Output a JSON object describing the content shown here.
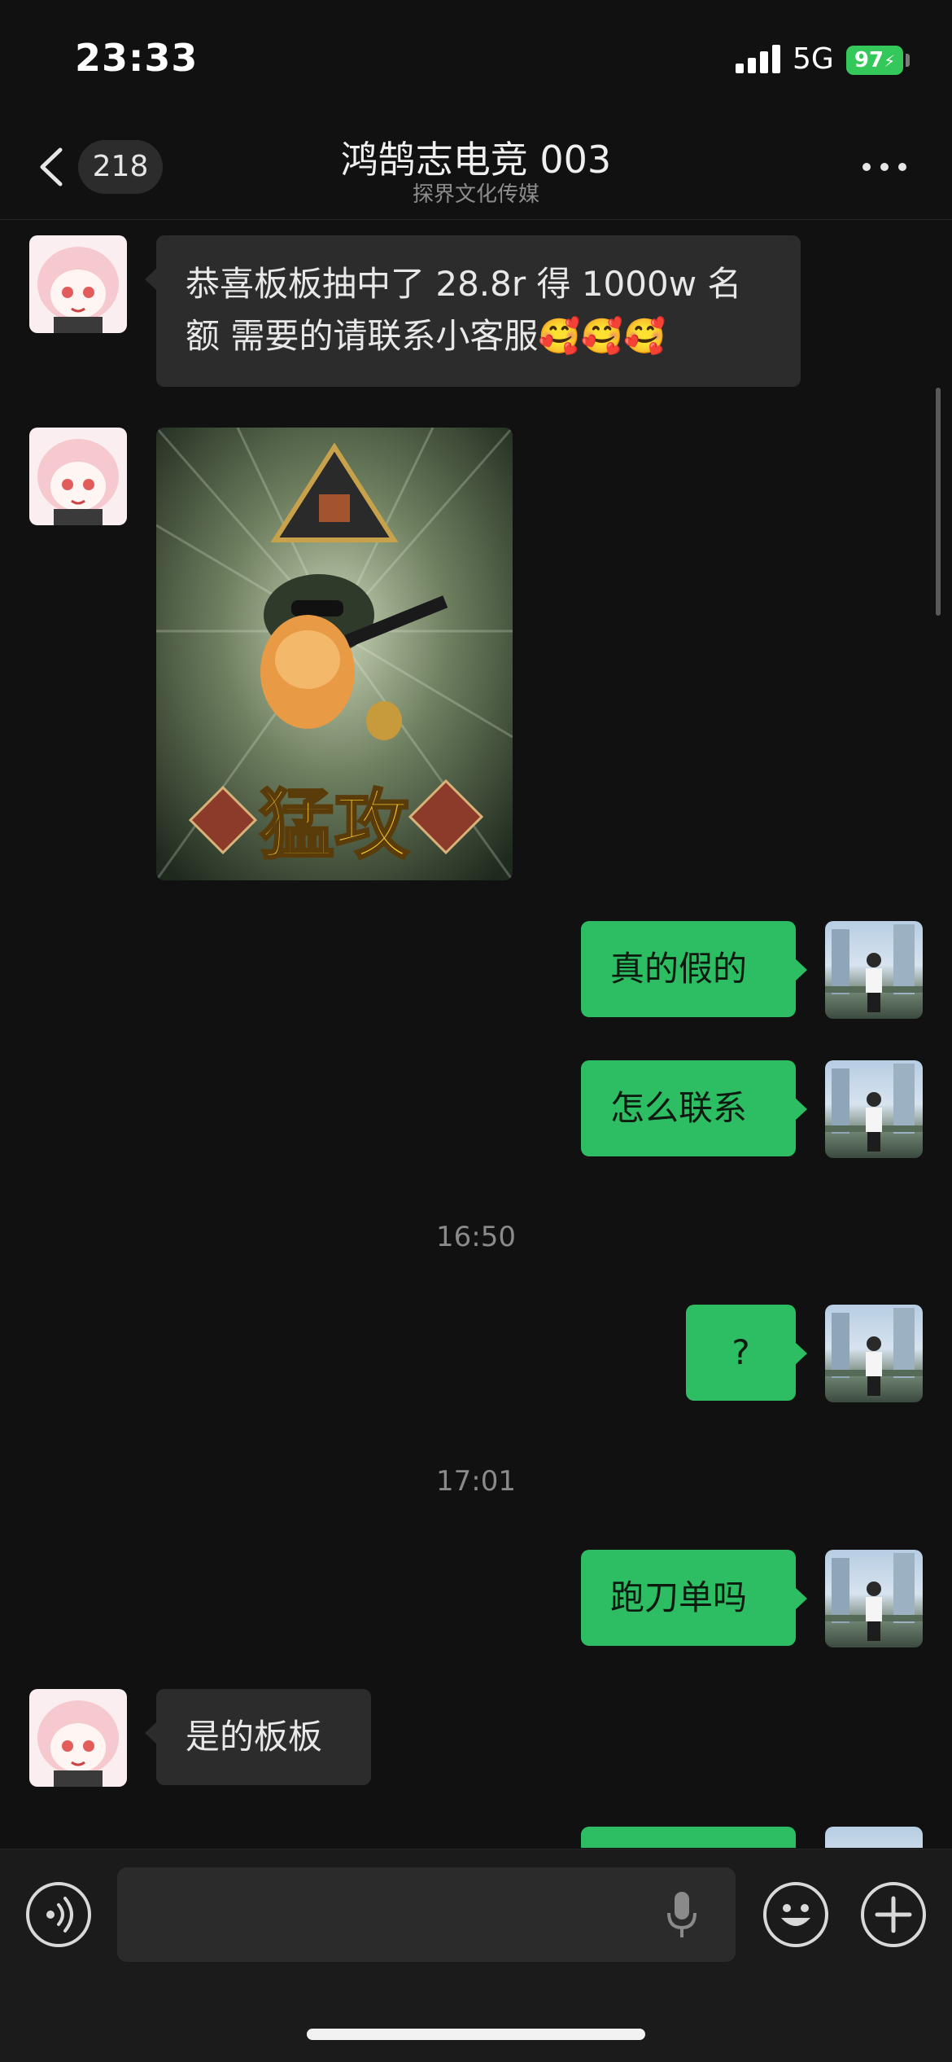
{
  "status_bar": {
    "time": "23:33",
    "network": "5G",
    "battery": "97"
  },
  "nav": {
    "unread_count": "218",
    "title": "鸿鹄志电竞 003",
    "subtitle": "探界文化传媒"
  },
  "messages": [
    {
      "type": "text",
      "direction": "in",
      "text": "恭喜板板抽中了 28.8r 得 1000w 名额 需要的请联系小客服🥰🥰🥰"
    },
    {
      "type": "image",
      "direction": "in",
      "caption": "猛攻"
    },
    {
      "type": "text",
      "direction": "out",
      "text": "真的假的"
    },
    {
      "type": "text",
      "direction": "out",
      "text": "怎么联系"
    },
    {
      "type": "timestamp",
      "text": "16:50"
    },
    {
      "type": "text",
      "direction": "out",
      "text": "?"
    },
    {
      "type": "timestamp",
      "text": "17:01"
    },
    {
      "type": "text",
      "direction": "out",
      "text": "跑刀单吗"
    },
    {
      "type": "text",
      "direction": "in",
      "text": "是的板板"
    }
  ],
  "colors": {
    "outgoing_bubble": "#2dbd63",
    "incoming_bubble": "#2c2c2c",
    "background": "#111111"
  },
  "icons": [
    "back-chevron-icon",
    "more-icon",
    "voice-icon",
    "microphone-icon",
    "emoji-icon",
    "plus-icon"
  ]
}
